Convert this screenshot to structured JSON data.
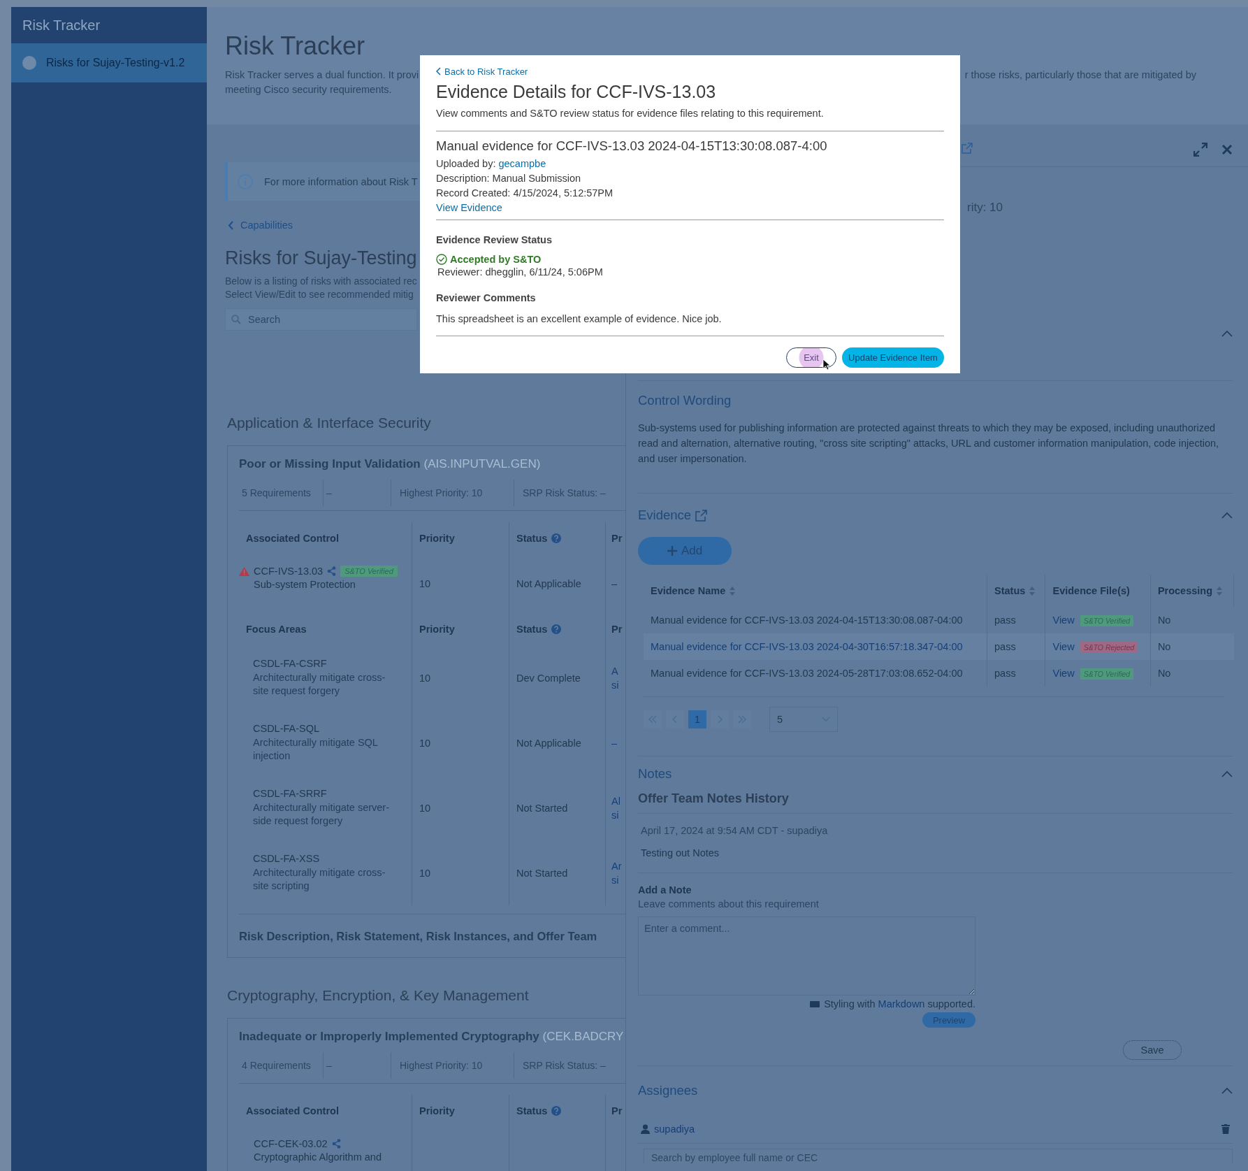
{
  "sidebar": {
    "title": "Risk Tracker",
    "items": [
      {
        "label": "Risks for Sujay-Testing-v1.2",
        "selected": true
      }
    ]
  },
  "header": {
    "title": "Risk Tracker",
    "description_left": "Risk Tracker serves a dual function. It provi",
    "description_right": "r those risks, particularly those that are mitigated by",
    "description_line_2": "meeting Cisco security requirements."
  },
  "info_banner": {
    "text": "For more information about Risk T"
  },
  "breadcrumb": {
    "label": "Capabilities"
  },
  "risks": {
    "title": "Risks for Sujay-Testing",
    "description_lines": [
      "Below is a listing of risks with associated rec",
      "Select View/Edit to see recommended mitig"
    ],
    "search": {
      "placeholder": "Search"
    }
  },
  "categories": [
    {
      "title": "Application & Interface Security",
      "risks": [
        {
          "name": "Poor or Missing Input Validation",
          "code": "(AIS.INPUTVAL.GEN)",
          "stats": [
            "5 Requirements",
            "–",
            "Highest Priority: 10",
            "SRP Risk Status: –"
          ],
          "control_columns": [
            {
              "label": "Associated Control",
              "help": false
            },
            {
              "label": "Priority",
              "help": false
            },
            {
              "label": "Status",
              "help": true
            },
            {
              "label": "Pr",
              "help": false
            }
          ],
          "controls": [
            {
              "id": "CCF-IVS-13.03",
              "name": "Sub-system Protection",
              "warning": true,
              "badge": "S&TO Verified",
              "priority": "10",
              "status": "Not Applicable",
              "column_4": "–"
            }
          ],
          "focus_columns": [
            {
              "label": "Focus Areas",
              "help": false
            },
            {
              "label": "Priority",
              "help": false
            },
            {
              "label": "Status",
              "help": true
            },
            {
              "label": "Pr",
              "help": false
            }
          ],
          "focus_areas": [
            {
              "id": "CSDL-FA-CSRF",
              "description": "Architecturally mitigate cross-site request forgery",
              "priority": "10",
              "status": "Dev Complete",
              "column_4": "A si"
            },
            {
              "id": "CSDL-FA-SQL",
              "description": "Architecturally mitigate SQL injection",
              "priority": "10",
              "status": "Not Applicable",
              "column_4": "–"
            },
            {
              "id": "CSDL-FA-SRRF",
              "description": "Architecturally mitigate server-side request forgery",
              "priority": "10",
              "status": "Not Started",
              "column_4": "Al si"
            },
            {
              "id": "CSDL-FA-XSS",
              "description": "Architecturally mitigate cross-site scripting",
              "priority": "10",
              "status": "Not Started",
              "column_4": "Ar si"
            }
          ],
          "footer": "Risk Description, Risk Statement, Risk Instances, and Offer Team"
        }
      ]
    },
    {
      "title": "Cryptography, Encryption, & Key Management",
      "risks": [
        {
          "name": "Inadequate or Improperly Implemented Cryptography",
          "code": "(CEK.BADCRY",
          "stats": [
            "4 Requirements",
            "–",
            "Highest Priority: 10",
            "SRP Risk Status: –"
          ],
          "control_columns": [
            {
              "label": "Associated Control",
              "help": false
            },
            {
              "label": "Priority",
              "help": false
            },
            {
              "label": "Status",
              "help": true
            },
            {
              "label": "Pr",
              "help": false
            }
          ],
          "controls": [
            {
              "id": "CCF-CEK-03.02",
              "name": "Cryptographic Algorithm and",
              "warning": false
            }
          ]
        }
      ]
    }
  ],
  "drawer": {
    "priority_fragment": "rity: 10",
    "covered_section": {
      "expanded": true
    },
    "control_wording": {
      "title": "Control Wording",
      "text": "Sub-systems used for publishing information are protected against threats to which they may be exposed, including unauthorized read and alternation, alternative routing, \"cross site scripting\" attacks, URL and customer information manipulation, code injection, and user impersonation."
    },
    "evidence": {
      "title": "Evidence",
      "expanded": true,
      "add_button": "Add",
      "columns": [
        {
          "label": "Evidence Name",
          "sortable": true
        },
        {
          "label": "Status",
          "sortable": true
        },
        {
          "label": "Evidence File(s)",
          "sortable": false
        },
        {
          "label": "Processing",
          "sortable": true
        }
      ],
      "rows": [
        {
          "name": "Manual evidence for CCF-IVS-13.03 2024-04-15T13:30:08.087-04:00",
          "highlighted": false,
          "status": "pass",
          "file_link": "View",
          "badge": {
            "label": "S&TO Verified",
            "kind": "verified"
          },
          "processing": "No"
        },
        {
          "name": "Manual evidence for CCF-IVS-13.03 2024-04-30T16:57:18.347-04:00",
          "highlighted": true,
          "status": "pass",
          "file_link": "View",
          "badge": {
            "label": "S&TO Rejected",
            "kind": "rejected"
          },
          "processing": "No"
        },
        {
          "name": "Manual evidence for CCF-IVS-13.03 2024-05-28T17:03:08.652-04:00",
          "highlighted": false,
          "status": "pass",
          "file_link": "View",
          "badge": {
            "label": "S&TO Verified",
            "kind": "verified"
          },
          "processing": "No"
        }
      ],
      "pagination": {
        "pages": [
          {
            "label": "1",
            "selected": true
          }
        ],
        "page_size": "5"
      }
    },
    "notes": {
      "title": "Notes",
      "expanded": true,
      "history_title": "Offer Team Notes History",
      "entries": [
        {
          "meta": "April 17, 2024 at 9:54 AM CDT - supadiya",
          "text": "Testing out Notes"
        }
      ],
      "add_title": "Add a Note",
      "add_hint": "Leave comments about this requirement",
      "comment_placeholder": "Enter a comment...",
      "markdown_hint": {
        "before": "Styling with ",
        "link": "Markdown",
        "after": " supported."
      },
      "preview_button": "Preview",
      "save_button": "Save"
    },
    "assignees": {
      "title": "Assignees",
      "expanded": true,
      "people": [
        {
          "name": "supadiya"
        }
      ],
      "search_placeholder": "Search by employee full name or CEC"
    }
  },
  "modal": {
    "back_link": "Back to Risk Tracker",
    "title": "Evidence Details for CCF-IVS-13.03",
    "subtitle": "View comments and S&TO review status for evidence files relating to this requirement.",
    "evidence_title": "Manual evidence for CCF-IVS-13.03 2024-04-15T13:30:08.087-4:00",
    "uploaded_by_label": "Uploaded by: ",
    "uploaded_by": "gecampbe",
    "description": "Description: Manual Submission",
    "record_created": "Record Created: 4/15/2024, 5:12:57PM",
    "view_link": "View Evidence",
    "review_status_heading": "Evidence Review Status",
    "review_status": {
      "label": "Accepted by S&TO",
      "kind": "accepted"
    },
    "reviewer": "Reviewer: dhegglin, 6/11/24, 5:06PM",
    "comments_heading": "Reviewer Comments",
    "comment": "This spreadsheet is an excellent example of evidence. Nice job.",
    "buttons": [
      {
        "label": "Exit",
        "kind": "secondary",
        "hovered": true
      },
      {
        "label": "Update Evidence Item",
        "kind": "primary",
        "hovered": false
      }
    ]
  }
}
